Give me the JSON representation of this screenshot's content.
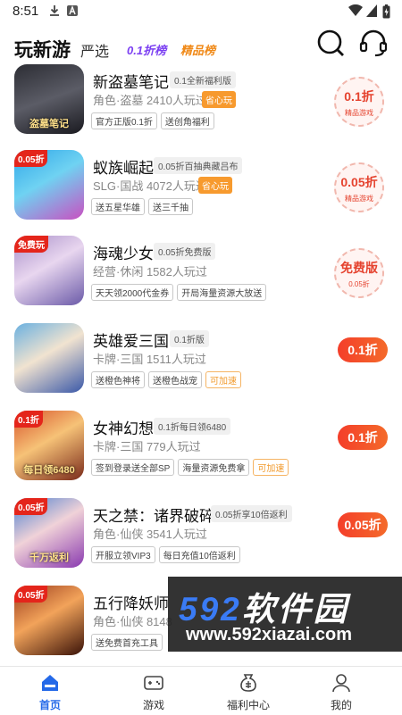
{
  "status": {
    "time": "8:51"
  },
  "nav": {
    "tabs": [
      "玩新游",
      "严选",
      "0.1折榜",
      "精品榜"
    ],
    "search_icon": "search-icon",
    "service_icon": "headset-icon"
  },
  "games": [
    {
      "title": "新盗墓笔记",
      "tag": "0.1全新福利版",
      "meta": "角色·盗墓  2410人玩过",
      "sheng": "省心玩",
      "chips": [
        "官方正版0.1折",
        "送创角福利"
      ],
      "stamp": "0.1折",
      "stamp_sub": "精品游戏",
      "cover_text": "盗墓笔记"
    },
    {
      "title": "蚁族崛起",
      "tag": "0.05折百抽典藏吕布",
      "meta": "SLG·国战  4072人玩过",
      "sheng": "省心玩",
      "chips": [
        "送五星华雄",
        "送三千抽"
      ],
      "stamp": "0.05折",
      "stamp_sub": "精品游戏",
      "cover_badge": "0.05折"
    },
    {
      "title": "海魂少女",
      "tag": "0.05折免费版",
      "meta": "经营·休闲  1582人玩过",
      "chips": [
        "天天领2000代金券",
        "开局海量资源大放送"
      ],
      "stamp": "免费版",
      "stamp_sub": "0.05折",
      "cover_badge": "免费玩"
    },
    {
      "title": "英雄爱三国",
      "tag": "0.1折版",
      "meta": "卡牌·三国  1511人玩过",
      "chips": [
        "送橙色神将",
        "送橙色战宠",
        "可加速"
      ],
      "pill": "0.1折"
    },
    {
      "title": "女神幻想",
      "tag": "0.1折每日领6480",
      "meta": "卡牌·三国  779人玩过",
      "chips": [
        "签到登录送全部SP",
        "海量资源免费拿",
        "可加速"
      ],
      "pill": "0.1折",
      "cover_badge": "0.1折",
      "cover_text": "每日领6480"
    },
    {
      "title": "天之禁：诸界破碎",
      "tag": "0.05折享10倍返利",
      "meta": "角色·仙侠  3541人玩过",
      "chips": [
        "开服立领VIP3",
        "每日充值10倍返利"
      ],
      "pill": "0.05折",
      "cover_badge": "0.05折",
      "cover_text": "千万返利"
    },
    {
      "title": "五行降妖师",
      "meta": "角色·仙侠  8148",
      "chips": [
        "送免费首充工具"
      ],
      "cover_badge": "0.05折"
    }
  ],
  "watermark": {
    "big_num": "592",
    "big_cn": "软件园",
    "url": "www.592xiazai.com"
  },
  "bottom_nav": [
    "首页",
    "游戏",
    "福利中心",
    "我的"
  ],
  "colors": {
    "accent": "#2469e8",
    "price": "#f43e2a",
    "sheng": "#f79a2e"
  }
}
